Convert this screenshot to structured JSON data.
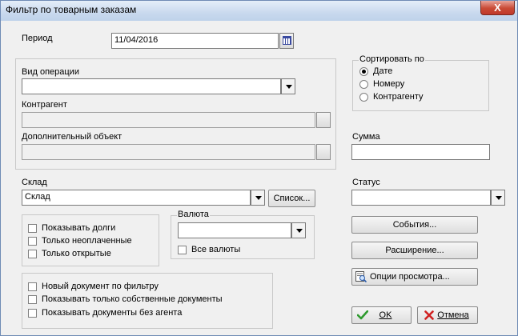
{
  "window": {
    "title": "Фильтр по товарным заказам",
    "close_glyph": "X"
  },
  "period": {
    "label": "Период",
    "value": "11/04/2016"
  },
  "operation": {
    "type_label": "Вид операции",
    "type_value": "",
    "counterparty_label": "Контрагент",
    "counterparty_value": "",
    "extra_label": "Дополнительный объект",
    "extra_value": ""
  },
  "sort": {
    "title": "Сортировать по",
    "options": [
      {
        "label": "Дате",
        "selected": true
      },
      {
        "label": "Номеру",
        "selected": false
      },
      {
        "label": "Контрагенту",
        "selected": false
      }
    ]
  },
  "sum": {
    "label": "Сумма",
    "value": ""
  },
  "warehouse": {
    "label": "Склад",
    "value": "Склад",
    "list_button": "Список..."
  },
  "status": {
    "label": "Статус",
    "value": ""
  },
  "flags": {
    "show_debts": "Показывать долги",
    "only_unpaid": "Только неоплаченные",
    "only_open": "Только открытые"
  },
  "currency": {
    "title": "Валюта",
    "value": "",
    "all_label": "Все валюты"
  },
  "buttons": {
    "events": "События...",
    "extension": "Расширение...",
    "view_options": "Опции просмотра...",
    "ok": "OK",
    "cancel": "Отмена"
  },
  "doc_flags": {
    "new_by_filter": "Новый документ по фильтру",
    "only_own": "Показывать только собственные документы",
    "without_agent": "Показывать документы без агента"
  }
}
